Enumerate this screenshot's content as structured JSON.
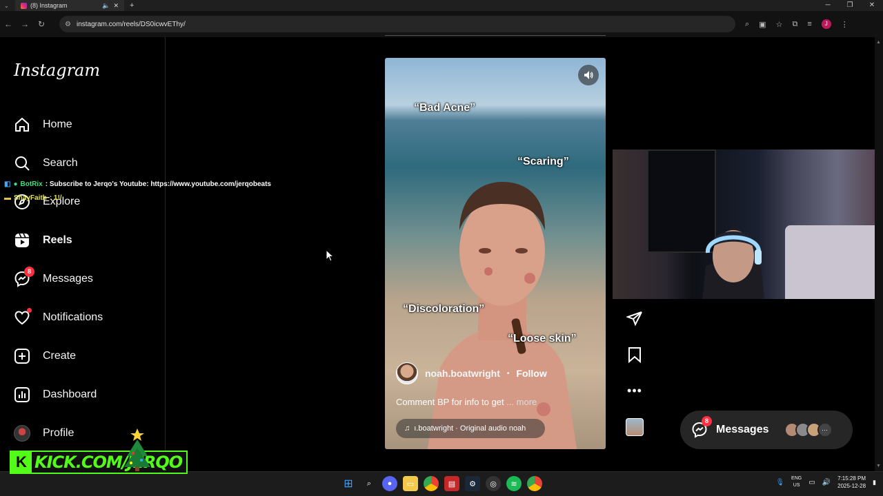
{
  "browser": {
    "tab_title": "(8) Instagram",
    "url": "instagram.com/reels/DS0icwvEThy/",
    "profile_initial": "J"
  },
  "sidebar": {
    "logo": "Instagram",
    "items": [
      {
        "label": "Home",
        "icon": "home-icon"
      },
      {
        "label": "Search",
        "icon": "search-icon"
      },
      {
        "label": "Explore",
        "icon": "compass-icon"
      },
      {
        "label": "Reels",
        "icon": "reels-icon",
        "active": true
      },
      {
        "label": "Messages",
        "icon": "messenger-icon",
        "badge": "8"
      },
      {
        "label": "Notifications",
        "icon": "heart-icon"
      },
      {
        "label": "Create",
        "icon": "plus-square-icon"
      },
      {
        "label": "Dashboard",
        "icon": "dashboard-icon"
      },
      {
        "label": "Profile",
        "icon": "profile-avatar"
      }
    ]
  },
  "stream_chat": [
    {
      "user": "BotRix",
      "message": ": Subscribe to Jerqo's Youtube: https://www.youtube.com/jerqobeats"
    },
    {
      "user": "ShayFaith",
      "message": ": 1!/"
    }
  ],
  "reel": {
    "labels": [
      "“Bad Acne”",
      "“Scaring”",
      "“Discoloration”",
      "“Loose skin”"
    ],
    "username": "noah.boatwright",
    "separator": "•",
    "follow": "Follow",
    "caption": "Comment BP for info to get",
    "more": "... more",
    "audio": "ı.boatwright · Original audio   noah"
  },
  "messages_pill": {
    "label": "Messages",
    "badge": "8"
  },
  "kick_overlay": {
    "text": "KICK.COM/JERQO"
  },
  "taskbar": {
    "lang_top": "ENG",
    "lang_bottom": "US",
    "time": "7:15:28 PM",
    "date": "2025-12-28"
  },
  "colors": {
    "accent_red": "#ff3040",
    "kick_green": "#53fc18",
    "background": "#000000"
  }
}
